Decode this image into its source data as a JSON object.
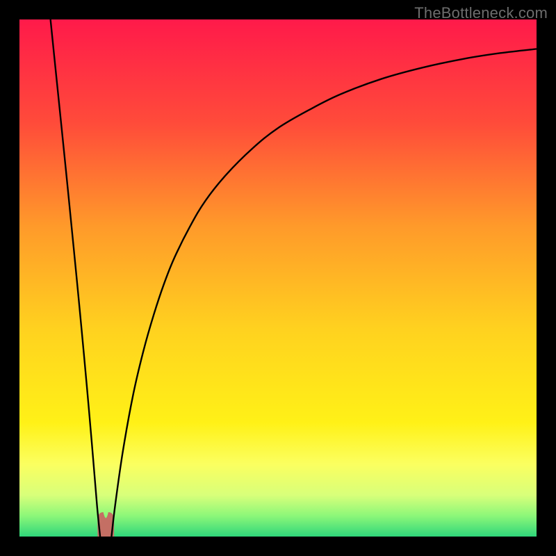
{
  "watermark": "TheBottleneck.com",
  "chart_data": {
    "type": "line",
    "title": "",
    "xlabel": "",
    "ylabel": "",
    "xlim": [
      0,
      100
    ],
    "ylim": [
      0,
      100
    ],
    "grid": false,
    "legend": false,
    "background_gradient_stops": [
      {
        "offset": 0.0,
        "color": "#ff1a4a"
      },
      {
        "offset": 0.2,
        "color": "#ff4b3a"
      },
      {
        "offset": 0.4,
        "color": "#ff9a2a"
      },
      {
        "offset": 0.6,
        "color": "#ffd21f"
      },
      {
        "offset": 0.78,
        "color": "#fff117"
      },
      {
        "offset": 0.86,
        "color": "#fbff60"
      },
      {
        "offset": 0.92,
        "color": "#d8ff7a"
      },
      {
        "offset": 0.96,
        "color": "#8cf779"
      },
      {
        "offset": 1.0,
        "color": "#2fd67a"
      }
    ],
    "bump": {
      "x": 16.7,
      "half_width": 1.6,
      "height": 4.7,
      "color": "#c46f64"
    },
    "series": [
      {
        "name": "left-branch",
        "x": [
          6.0,
          7.0,
          8.0,
          9.0,
          10.0,
          11.0,
          12.0,
          13.0,
          14.0,
          15.0,
          15.6
        ],
        "y": [
          100.0,
          90.2,
          80.5,
          70.7,
          60.7,
          50.6,
          40.2,
          29.4,
          18.0,
          6.0,
          0.0
        ]
      },
      {
        "name": "right-branch",
        "x": [
          17.8,
          18.5,
          20.0,
          22.0,
          24.0,
          26.0,
          28.0,
          30.0,
          33.0,
          36.0,
          40.0,
          45.0,
          50.0,
          56.0,
          62.0,
          70.0,
          78.0,
          86.0,
          93.0,
          100.0
        ],
        "y": [
          0.0,
          6.0,
          16.5,
          27.5,
          36.0,
          43.0,
          49.0,
          54.0,
          60.0,
          65.0,
          70.0,
          75.0,
          79.0,
          82.5,
          85.5,
          88.5,
          90.7,
          92.4,
          93.5,
          94.3
        ]
      }
    ]
  }
}
